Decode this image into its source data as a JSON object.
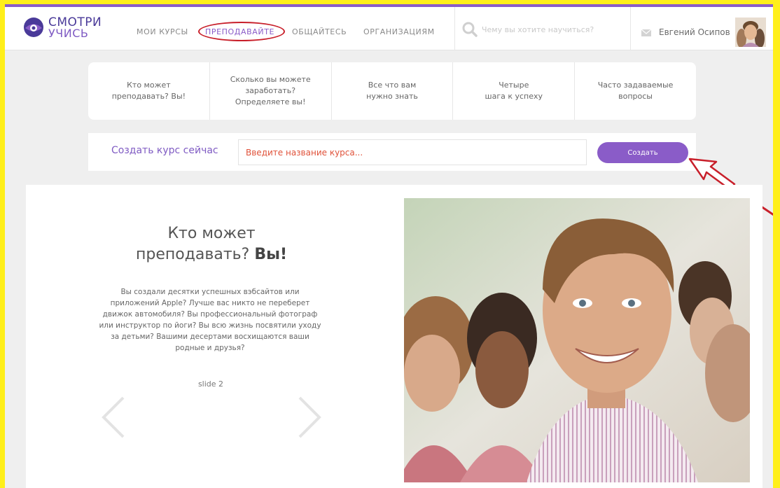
{
  "logo": {
    "line1": "СМОТРИ",
    "line2": "УЧИСЬ"
  },
  "nav": {
    "items": [
      {
        "label": "МОИ КУРСЫ"
      },
      {
        "label": "ПРЕПОДАВАЙТЕ"
      },
      {
        "label": "ОБЩАЙТЕСЬ"
      },
      {
        "label": "ОРГАНИЗАЦИЯМ"
      }
    ]
  },
  "search": {
    "placeholder": "Чему вы хотите научиться?"
  },
  "user": {
    "name": "Евгений Осипов"
  },
  "tabs": [
    {
      "label": "Кто может\nпреподавать? Вы!"
    },
    {
      "label": "Сколько вы можете\nзаработать?\nОпределяете вы!"
    },
    {
      "label": "Все что вам\nнужно знать"
    },
    {
      "label": "Четыре\nшага к успеху"
    },
    {
      "label": "Часто задаваемые\nвопросы"
    }
  ],
  "create": {
    "label": "Создать курс сейчас",
    "input_placeholder": "Введите название курса...",
    "button_label": "Создать"
  },
  "hero": {
    "title_line1": "Кто может",
    "title_line2": "преподавать?",
    "title_bold": "Вы!",
    "text": "Вы создали десятки успешных вэбсайтов или приложений Apple? Лучше вас никто не переберет движок автомобиля? Вы профессиональный фотограф или инструктор по йоги? Вы всю жизнь посвятили уходу за детьми? Вашими десертами восхищаются ваши родные и друзья?",
    "slide_label": "slide 2"
  },
  "colors": {
    "accent": "#8a5cc8",
    "annotation_frame": "#ffef1a",
    "annotation_mark": "#c81f2a",
    "placeholder_red": "#e0523a"
  },
  "icons": [
    "logo-eye-icon",
    "search-icon",
    "mail-icon",
    "chevron-left-icon",
    "chevron-right-icon",
    "annotation-arrow-icon"
  ]
}
